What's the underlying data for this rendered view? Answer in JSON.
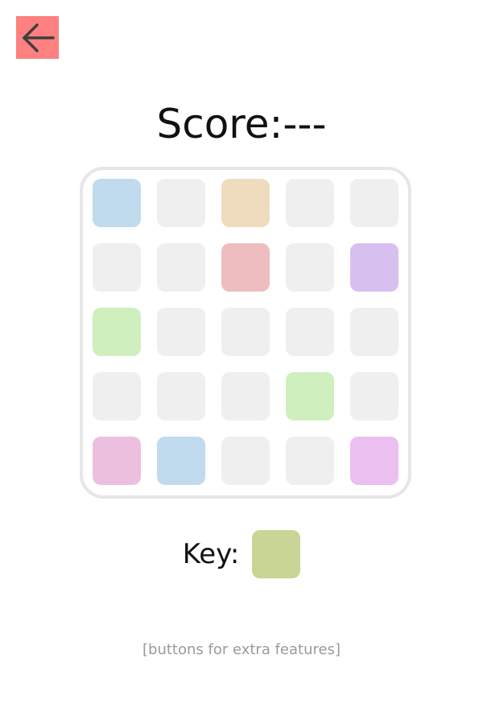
{
  "header": {
    "back_icon": "arrow-left-icon",
    "back_color": "#ff8080"
  },
  "score": {
    "label": "Score:---"
  },
  "board": {
    "border_color": "#e6e6e6",
    "tiles": [
      [
        "#bfdbed",
        "#efefef",
        "#efdcbf",
        "#efefef",
        "#efefef"
      ],
      [
        "#efefef",
        "#efefef",
        "#edbdbf",
        "#efefef",
        "#d7bfef"
      ],
      [
        "#cfefbf",
        "#efefef",
        "#efefef",
        "#efefef",
        "#efefef"
      ],
      [
        "#efefef",
        "#efefef",
        "#efefef",
        "#cfefbf",
        "#efefef"
      ],
      [
        "#edbfdf",
        "#bfdbed",
        "#efefef",
        "#efefef",
        "#ebbfef"
      ]
    ]
  },
  "key": {
    "label": "Key:",
    "color": "#c8d595"
  },
  "footer": {
    "text": "[buttons for extra features]"
  }
}
